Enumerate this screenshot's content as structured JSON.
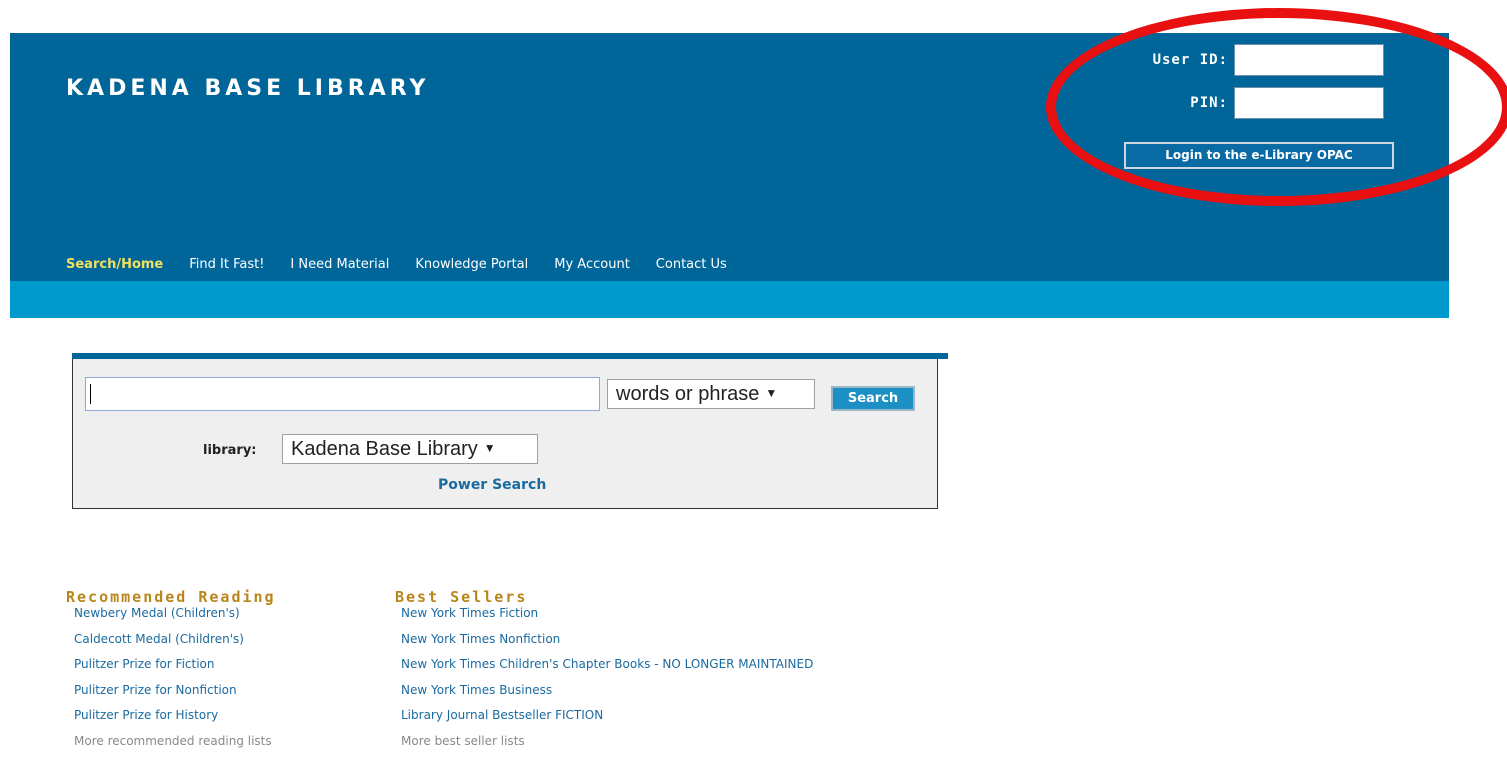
{
  "header": {
    "site_title": "KADENA BASE LIBRARY",
    "colors": {
      "header_bg": "#00669a",
      "stripe_bg": "#0099cc",
      "active_nav": "#f0e060",
      "annotation": "#e81010"
    }
  },
  "login": {
    "user_id_label": "User ID:",
    "pin_label": "PIN:",
    "user_id_value": "",
    "pin_value": "",
    "button_label": "Login to the e-Library OPAC"
  },
  "nav": {
    "items": [
      {
        "label": "Search/Home",
        "active": true
      },
      {
        "label": "Find It Fast!",
        "active": false
      },
      {
        "label": "I Need Material",
        "active": false
      },
      {
        "label": "Knowledge Portal",
        "active": false
      },
      {
        "label": "My Account",
        "active": false
      },
      {
        "label": "Contact Us",
        "active": false
      }
    ]
  },
  "search": {
    "query_value": "",
    "mode_selected": "words or phrase",
    "button_label": "Search",
    "library_label": "library:",
    "library_selected": "Kadena Base Library",
    "power_search_label": "Power Search"
  },
  "recommended": {
    "heading": "Recommended Reading",
    "items": [
      "Newbery Medal (Children's)",
      "Caldecott Medal (Children's)",
      "Pulitzer Prize for Fiction",
      "Pulitzer Prize for Nonfiction",
      "Pulitzer Prize for History"
    ],
    "more": "More recommended reading lists"
  },
  "bestsellers": {
    "heading": "Best Sellers",
    "items": [
      "New York Times Fiction",
      "New York Times Nonfiction",
      "New York Times Children's Chapter Books - NO LONGER MAINTAINED",
      "New York Times Business",
      "Library Journal Bestseller FICTION"
    ],
    "more": "More best seller lists"
  }
}
